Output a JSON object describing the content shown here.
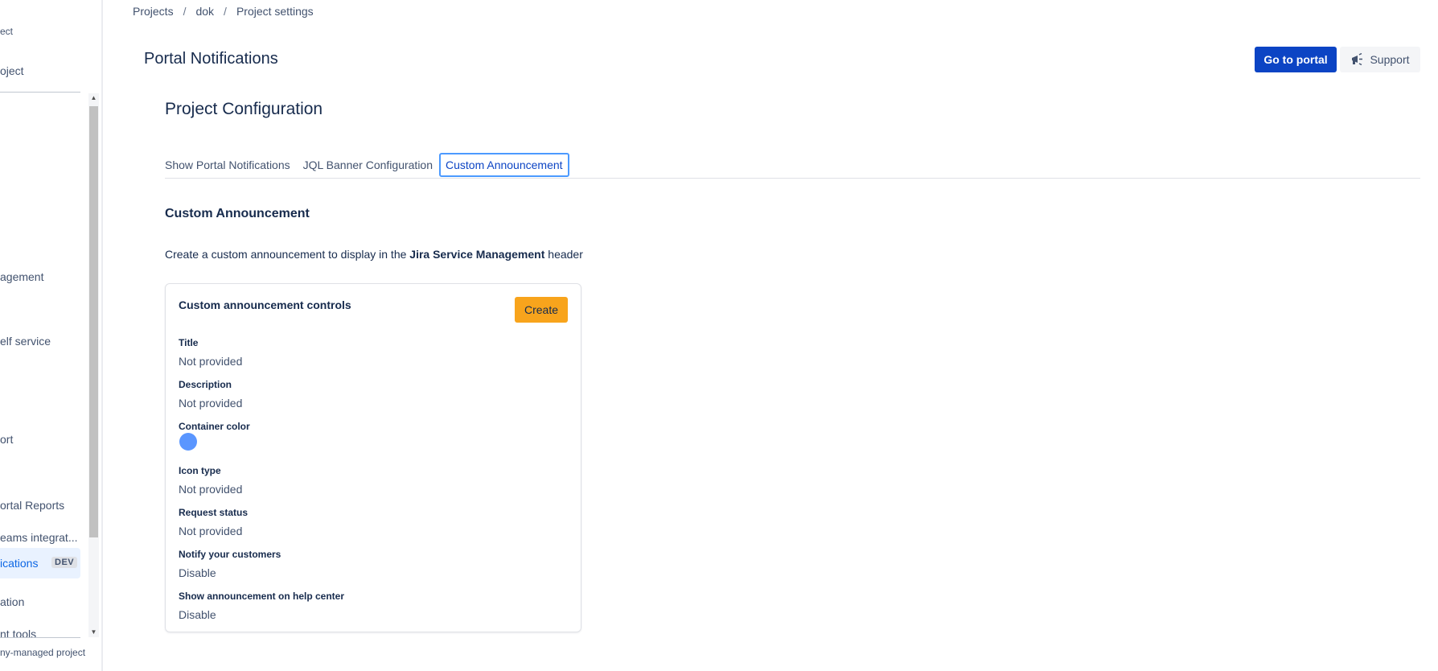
{
  "sidebar": {
    "top_text_1": "ect",
    "top_text_2": "oject",
    "items": [
      {
        "label": "agement"
      },
      {
        "label": "elf service"
      },
      {
        "label": "ort"
      },
      {
        "label": "ortal Reports"
      },
      {
        "label": "eams integrat..."
      },
      {
        "label": "ications",
        "badge": "DEV"
      },
      {
        "label": "ation"
      },
      {
        "label": "nt tools"
      }
    ],
    "footer": "ny-managed project"
  },
  "breadcrumb": [
    "Projects",
    "dok",
    "Project settings"
  ],
  "header": {
    "title": "Portal Notifications",
    "go_to_portal": "Go to portal",
    "support": "Support"
  },
  "config": {
    "heading": "Project Configuration",
    "tabs": [
      {
        "label": "Show Portal Notifications"
      },
      {
        "label": "JQL Banner Configuration"
      },
      {
        "label": "Custom Announcement"
      }
    ]
  },
  "announcement": {
    "heading": "Custom Announcement",
    "description_prefix": "Create a custom announcement to display in the ",
    "description_bold": "Jira Service Management",
    "description_suffix": " header",
    "card": {
      "title": "Custom announcement controls",
      "create_label": "Create",
      "fields": [
        {
          "label": "Title",
          "value": "Not provided"
        },
        {
          "label": "Description",
          "value": "Not provided"
        },
        {
          "label": "Container color",
          "color": "#5A96FF"
        },
        {
          "label": "Icon type",
          "value": "Not provided"
        },
        {
          "label": "Request status",
          "value": "Not provided"
        },
        {
          "label": "Notify your customers",
          "value": "Disable"
        },
        {
          "label": "Show announcement on help center",
          "value": "Disable"
        }
      ]
    }
  }
}
